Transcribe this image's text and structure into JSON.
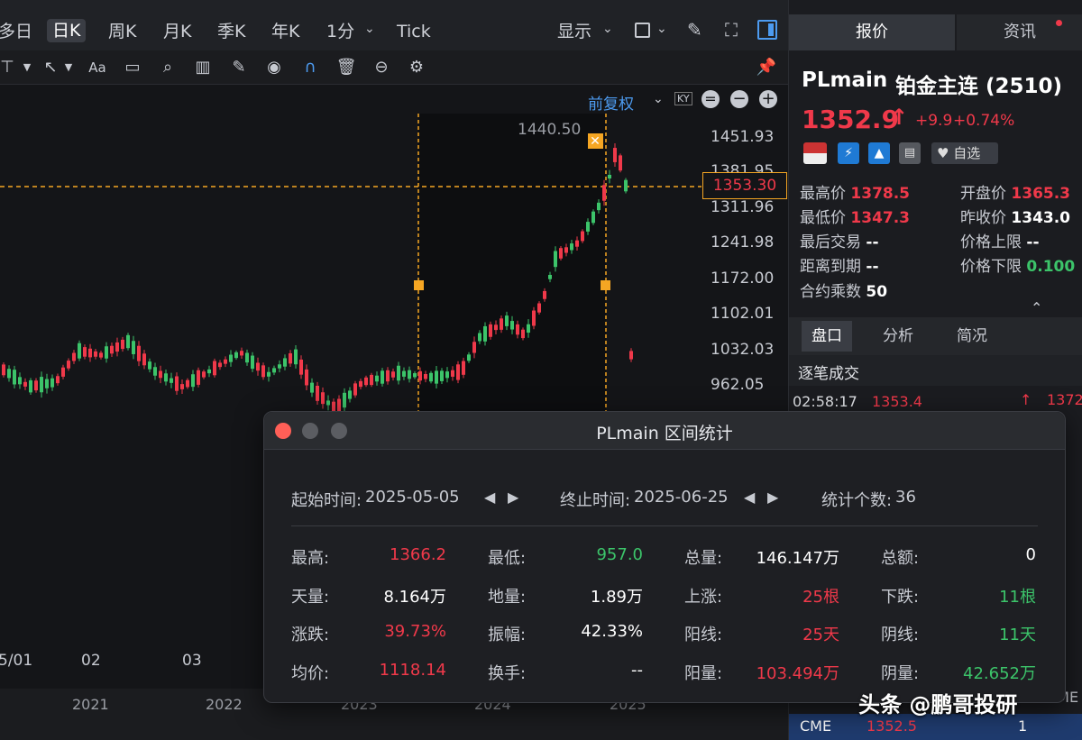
{
  "toolbar": {
    "periods": [
      "多日",
      "日K",
      "周K",
      "月K",
      "季K",
      "年K",
      "1分",
      "Tick"
    ],
    "active_period": "日K",
    "display_label": "显示"
  },
  "chart": {
    "adjust_label": "前复权",
    "price_ticks": [
      "1451.93",
      "1381.95",
      "1311.96",
      "1241.98",
      "1172.00",
      "1102.01",
      "1032.03",
      "962.05"
    ],
    "crosshair_price": "1353.30",
    "high_marker": "1440.50",
    "x_ticks": [
      "5/01",
      "02",
      "03"
    ],
    "year_ticks": [
      "2021",
      "2022",
      "2023",
      "2024",
      "2025"
    ]
  },
  "right_panel": {
    "tabs": [
      "报价",
      "资讯"
    ],
    "symbol": "PLmain",
    "name": "铂金主连 (2510)",
    "last_price": "1352.9",
    "change": "+9.9",
    "change_pct": "+0.74%",
    "watch_label": "自选",
    "quote": {
      "high_label": "最高价",
      "high": "1378.5",
      "open_label": "开盘价",
      "open": "1365.3",
      "low_label": "最低价",
      "low": "1347.3",
      "prev_close_label": "昨收价",
      "prev_close": "1343.0",
      "last_trade_label": "最后交易",
      "last_trade": "--",
      "upper_limit_label": "价格上限",
      "upper_limit": "--",
      "to_expiry_label": "距离到期",
      "to_expiry": "--",
      "lower_limit_label": "价格下限",
      "lower_limit": "0.100",
      "multiplier_label": "合约乘数",
      "multiplier": "50"
    },
    "sub_tabs": [
      "盘口",
      "分析",
      "简况"
    ],
    "ticks_title": "逐笔成交",
    "tick_row": {
      "time": "02:58:17",
      "price": "1353.4",
      "right": "1372"
    },
    "bottom_row": {
      "exchange": "CME",
      "price": "1352.5",
      "qty": "1",
      "right": "CME"
    }
  },
  "dialog": {
    "title": "PLmain 区间统计",
    "start_label": "起始时间:",
    "start": "2025-05-05",
    "end_label": "终止时间:",
    "end": "2025-06-25",
    "count_label": "统计个数:",
    "count": "36",
    "stats": {
      "high_l": "最高:",
      "high": "1366.2",
      "low_l": "最低:",
      "low": "957.0",
      "vol_l": "总量:",
      "vol": "146.147万",
      "amt_l": "总额:",
      "amt": "0",
      "top_vol_l": "天量:",
      "top_vol": "8.164万",
      "bot_vol_l": "地量:",
      "bot_vol": "1.89万",
      "up_l": "上涨:",
      "up": "25根",
      "down_l": "下跌:",
      "down": "11根",
      "chg_l": "涨跌:",
      "chg": "39.73%",
      "amp_l": "振幅:",
      "amp": "42.33%",
      "yang_l": "阳线:",
      "yang": "25天",
      "yin_l": "阴线:",
      "yin": "11天",
      "avg_l": "均价:",
      "avg": "1118.14",
      "turn_l": "换手:",
      "turn": "--",
      "yang_vol_l": "阳量:",
      "yang_vol": "103.494万",
      "yin_vol_l": "阴量:",
      "yin_vol": "42.652万"
    }
  },
  "watermark": "头条 @鹏哥投研",
  "colors": {
    "up": "#f0394a",
    "down": "#3cc46a",
    "accent": "#f5a623",
    "link": "#4d9bf0"
  }
}
